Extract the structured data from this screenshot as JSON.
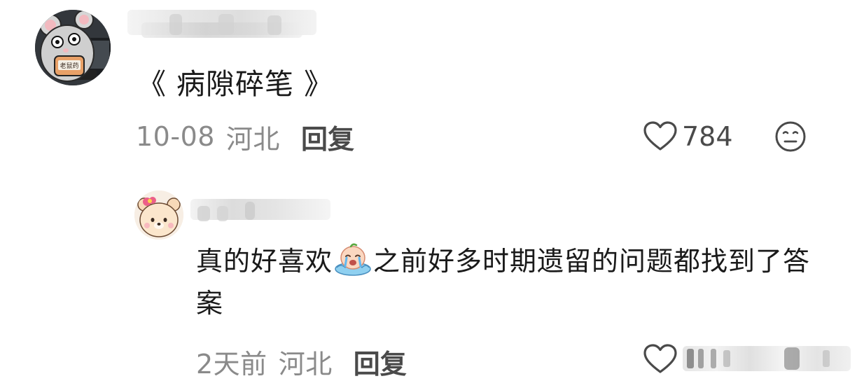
{
  "comments": [
    {
      "text": "《 病隙碎笔 》",
      "date": "10-08",
      "location": "河北",
      "reply_label": "回复",
      "like_count": "784",
      "avatar_badge": "老鼠药"
    },
    {
      "text_before": "真的好喜欢",
      "text_after": "之前好多时期遗留的问题都找到了答案",
      "date": "2天前",
      "location": "河北",
      "reply_label": "回复"
    }
  ],
  "colors": {
    "meta_gray": "#8a8a8a",
    "action_gray": "#4a4a4a",
    "text": "#1a1a1a"
  },
  "icons": {
    "like": "heart-outline-icon",
    "dislike": "neutral-face-icon",
    "emoji": "crying-face-emoji"
  }
}
